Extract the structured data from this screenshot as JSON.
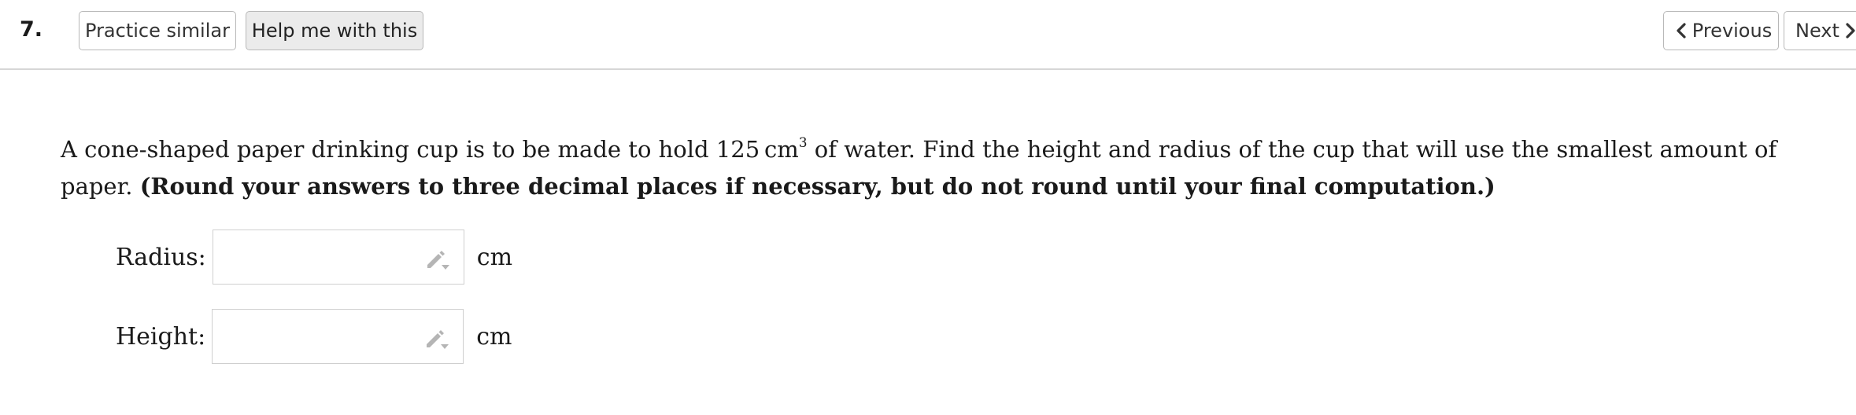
{
  "header": {
    "question_number": "7.",
    "practice_label": "Practice similar",
    "help_label": "Help me with this",
    "previous_label": "Previous",
    "next_label": "Next"
  },
  "question": {
    "text_before": "A cone-shaped paper drinking cup is to be made to hold ",
    "volume_value": "125",
    "volume_unit": "cm",
    "volume_exponent": "3",
    "text_after": " of water. Find the height and radius of the cup that will use the smallest amount of paper. ",
    "instruction_bold": "(Round your answers to three decimal places if necessary, but do not round until your final computation.)"
  },
  "fields": {
    "radius": {
      "label": "Radius:",
      "value": "",
      "unit": "cm",
      "icon": "pencil-dropdown-icon"
    },
    "height": {
      "label": "Height:",
      "value": "",
      "unit": "cm",
      "icon": "pencil-dropdown-icon"
    }
  }
}
